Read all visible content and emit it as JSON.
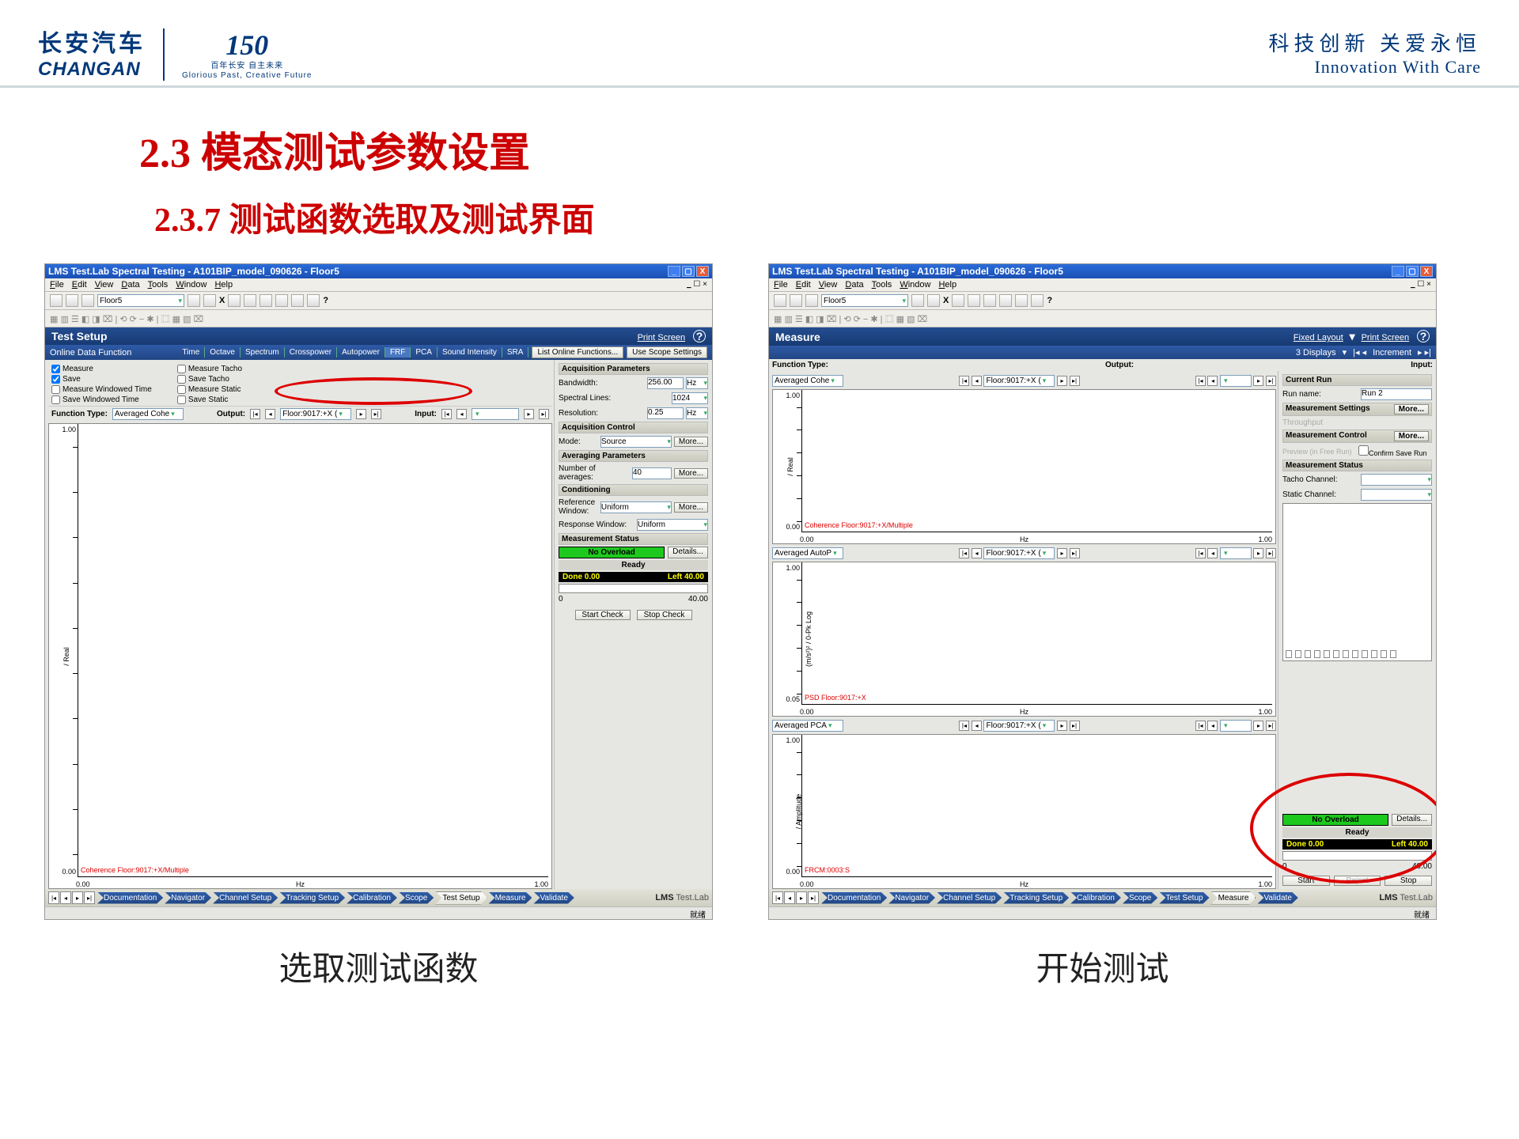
{
  "doc_header": {
    "brand_cn": "长安汽车",
    "brand_en": "CHANGAN",
    "anni_num": "150",
    "anni_cn1": "百年长安 自主未来",
    "anni_cn2": "Glorious Past, Creative Future",
    "slogan_cn": "科技创新 关爱永恒",
    "slogan_en": "Innovation With Care"
  },
  "section_title": "2.3 模态测试参数设置",
  "sub_title": "2.3.7 测试函数选取及测试界面",
  "caption_left": "选取测试函数",
  "caption_right": "开始测试",
  "window_title": "LMS Test.Lab Spectral Testing - A101BIP_model_090626 - Floor5",
  "menubar": [
    "File",
    "Edit",
    "View",
    "Data",
    "Tools",
    "Window",
    "Help"
  ],
  "toolbar_combo": "Floor5",
  "panel_left": {
    "title": "Test Setup",
    "print": "Print Screen",
    "sub_label": "Online Data Function",
    "tabs": [
      "Time",
      "Octave",
      "Spectrum",
      "Crosspower",
      "Autopower",
      "FRF",
      "PCA",
      "Sound Intensity",
      "SRA"
    ],
    "btn_list": "List Online Functions...",
    "btn_scope": "Use Scope Settings"
  },
  "checks": {
    "c1": [
      "Measure",
      "Save",
      "Measure Windowed Time",
      "Save Windowed Time"
    ],
    "c2": [
      "Measure Tacho",
      "Save Tacho",
      "Measure Static",
      "Save Static"
    ]
  },
  "func_row": {
    "ft_label": "Function Type:",
    "ft_value": "Averaged Cohe",
    "out_label": "Output:",
    "out_value": "Floor:9017:+X (",
    "in_label": "Input:"
  },
  "chart": {
    "ytop": "1.00",
    "ybot": "0.00",
    "xlabel": "Hz",
    "x0": "0.00",
    "x1": "1.00",
    "red": "Coherence Floor:9017:+X/Multiple",
    "ylabel_rot": "/ Real"
  },
  "side_left": {
    "aq_params": "Acquisition Parameters",
    "bw": "Bandwidth:",
    "bw_v": "256.00",
    "bw_u": "Hz",
    "sl": "Spectral Lines:",
    "sl_v": "1024",
    "res": "Resolution:",
    "res_v": "0.25",
    "res_u": "Hz",
    "aq_ctrl": "Acquisition Control",
    "mode": "Mode:",
    "mode_v": "Source",
    "more": "More...",
    "avg_params": "Averaging Parameters",
    "na": "Number of averages:",
    "na_v": "40",
    "cond": "Conditioning",
    "refw": "Reference Window:",
    "refw_v": "Uniform",
    "resw": "Response Window:",
    "resw_v": "Uniform",
    "mstat": "Measurement Status",
    "no_over": "No Overload",
    "ready": "Ready",
    "done": "Done 0.00",
    "left": "Left 40.00",
    "c0": "0",
    "c40": "40.00",
    "b1": "Start Check",
    "b2": "Stop Check",
    "details": "Details..."
  },
  "panel_right": {
    "title": "Measure",
    "fixed": "Fixed Layout",
    "print": "Print Screen",
    "sub_labels": [
      "3 Displays",
      "Increment"
    ],
    "ft_label": "Function Type:",
    "out_label": "Output:",
    "in_label": "Input:"
  },
  "right_charts": [
    {
      "ft": "Averaged Cohe",
      "out": "Floor:9017:+X (",
      "red": "Coherence Floor:9017:+X/Multiple",
      "yl": "/ Real"
    },
    {
      "ft": "Averaged AutoP",
      "out": "Floor:9017:+X (",
      "red": "PSD Floor:9017:+X",
      "yl": "(m/s²)² / 0-Pk Log"
    },
    {
      "ft": "Averaged PCA",
      "out": "Floor:9017:+X (",
      "red": "FRCM:0003:S",
      "yl": "/ Amplitude"
    }
  ],
  "right_small_chart": {
    "ytop": "1.00",
    "ybot": "0.00",
    "ybot2": "0.05",
    "x0": "0.00",
    "x1": "1.00",
    "xlabel": "Hz"
  },
  "side_right": {
    "cur_run": "Current Run",
    "run_name": "Run name:",
    "run_name_v": "Run 2",
    "msettings": "Measurement Settings",
    "throughput": "Throughput",
    "more": "More...",
    "mcontrol": "Measurement Control",
    "preview": "Preview (in Free Run)",
    "confirm": "Confirm Save Run",
    "mstatus": "Measurement Status",
    "tacho": "Tacho Channel:",
    "static": "Static Channel:",
    "no_over": "No Overload",
    "ready": "Ready",
    "done": "Done 0.00",
    "left": "Left 40.00",
    "c0": "0",
    "c40": "40.00",
    "b_start": "Start",
    "b_reject": "Reject",
    "b_stop": "Stop",
    "details": "Details..."
  },
  "bottom_tabs": [
    "Documentation",
    "Navigator",
    "Channel Setup",
    "Tracking Setup",
    "Calibration",
    "Scope",
    "Test Setup",
    "Measure",
    "Validate"
  ],
  "brand_label_b": "LMS",
  "brand_label": " Test.Lab",
  "statusbar": "就绪"
}
